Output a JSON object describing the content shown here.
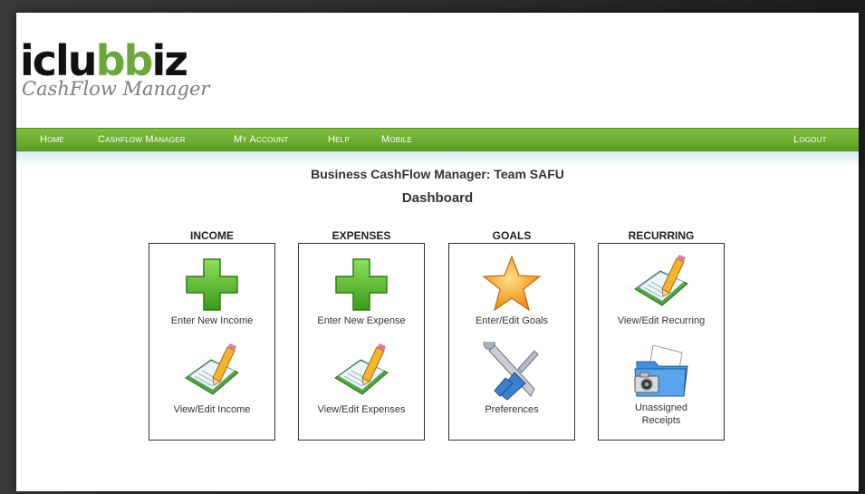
{
  "logo": {
    "word_a": "iclu",
    "word_b": "b",
    "word_c": "b",
    "word_d": "iz",
    "subtitle": "CashFlow Manager"
  },
  "nav": {
    "items": [
      "Home",
      "Cashflow Manager",
      "My Account",
      "Help",
      "Mobile"
    ],
    "logout": "Logout"
  },
  "page": {
    "title": "Business CashFlow Manager: Team SAFU",
    "subtitle": "Dashboard"
  },
  "sections": [
    {
      "heading": "INCOME",
      "tiles": [
        {
          "label": "Enter New Income",
          "icon": "plus-icon"
        },
        {
          "label": "View/Edit Income",
          "icon": "notebook-icon"
        }
      ]
    },
    {
      "heading": "EXPENSES",
      "tiles": [
        {
          "label": "Enter New Expense",
          "icon": "plus-icon"
        },
        {
          "label": "View/Edit Expenses",
          "icon": "notebook-icon"
        }
      ]
    },
    {
      "heading": "GOALS",
      "tiles": [
        {
          "label": "Enter/Edit Goals",
          "icon": "star-icon"
        },
        {
          "label": "Preferences",
          "icon": "tools-icon"
        }
      ]
    },
    {
      "heading": "RECURRING",
      "tiles": [
        {
          "label": "View/Edit Recurring",
          "icon": "notebook-icon"
        },
        {
          "label": "Unassigned Receipts",
          "icon": "camera-folder-icon"
        }
      ]
    }
  ],
  "colors": {
    "nav_green": "#6aa83a",
    "plus_green": "#5bb82e",
    "star_orange": "#f5a623"
  }
}
